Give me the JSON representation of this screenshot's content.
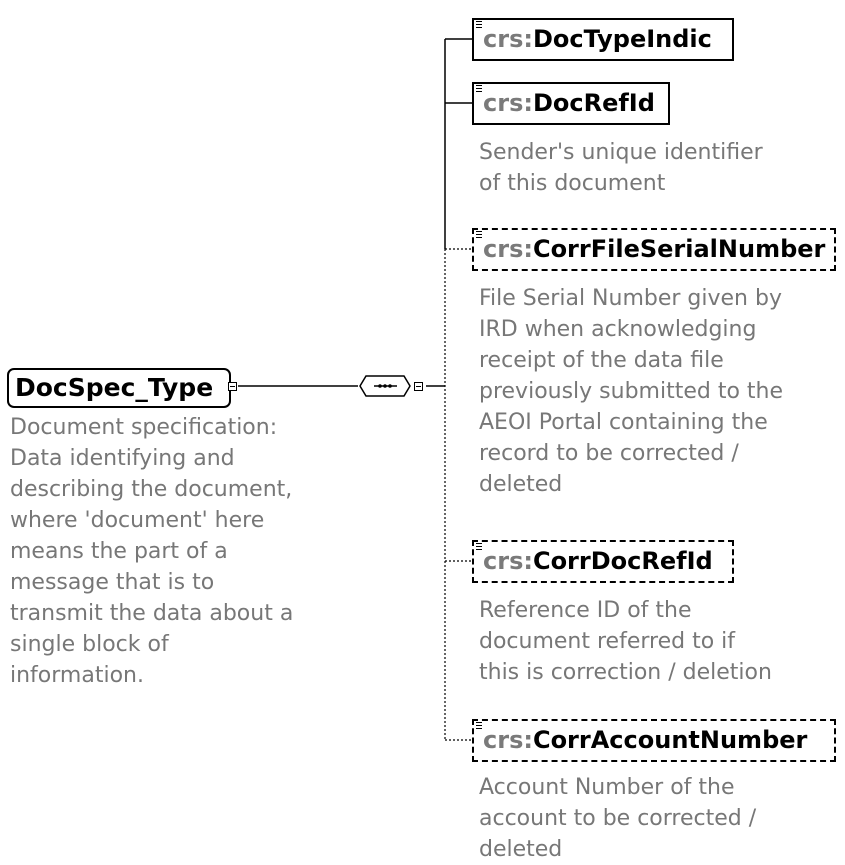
{
  "root": {
    "name": "DocSpec_Type",
    "description": "Document specification:\nData identifying and\ndescribing the document,\nwhere 'document' here\nmeans the part of a\nmessage that is to\ntransmit the data about a\nsingle block of\ninformation."
  },
  "children": [
    {
      "prefix": "crs:",
      "name": "DocTypeIndic",
      "optional": false,
      "description": ""
    },
    {
      "prefix": "crs:",
      "name": "DocRefId",
      "optional": false,
      "description": "Sender's unique identifier\nof this document"
    },
    {
      "prefix": "crs:",
      "name": "CorrFileSerialNumber",
      "optional": true,
      "description": "File Serial Number given by\nIRD when acknowledging\nreceipt of the data file\npreviously submitted to the\nAEOI Portal containing the\nrecord to be corrected /\ndeleted"
    },
    {
      "prefix": "crs:",
      "name": "CorrDocRefId",
      "optional": true,
      "description": "Reference ID of the\ndocument referred to if\nthis is correction / deletion"
    },
    {
      "prefix": "crs:",
      "name": "CorrAccountNumber",
      "optional": true,
      "description": "Account Number of the\naccount to be corrected /\ndeleted"
    }
  ],
  "colors": {
    "line": "#000000",
    "description_text": "#777777",
    "prefix_text": "#7a7a7a",
    "shadow": "#a8a8a8"
  }
}
